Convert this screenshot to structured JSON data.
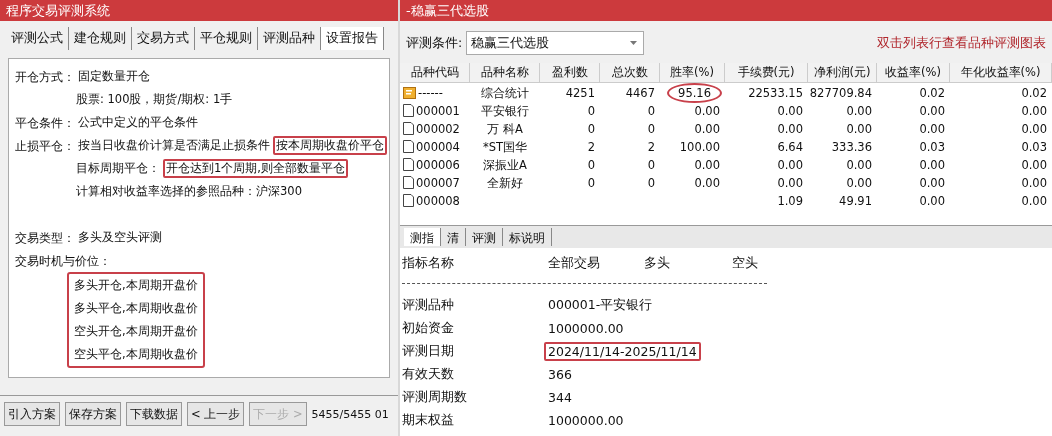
{
  "left_window": {
    "title": "程序交易评测系统",
    "tabs": [
      {
        "label": "评测公式",
        "selected": false
      },
      {
        "label": "建仓规则",
        "selected": false
      },
      {
        "label": "交易方式",
        "selected": false
      },
      {
        "label": "平仓规则",
        "selected": false
      },
      {
        "label": "评测品种",
        "selected": false
      },
      {
        "label": "设置报告",
        "selected": true
      }
    ],
    "settings": [
      {
        "label": "开仓方式：",
        "parts": [
          {
            "text": "固定数量开仓",
            "highlighted": false
          }
        ]
      },
      {
        "parts": [
          {
            "text": "股票: 100股，期货/期权: 1手",
            "highlighted": false
          }
        ]
      },
      {
        "label": "平仓条件：",
        "parts": [
          {
            "text": "公式中定义的平仓条件",
            "highlighted": false
          }
        ]
      },
      {
        "label": "止损平仓：",
        "parts": [
          {
            "text": "按当日收盘价计算是否满足止损条件",
            "highlighted": false
          },
          {
            "text": "按本周期收盘价平仓",
            "highlighted": true
          }
        ]
      },
      {
        "parts": [
          {
            "text": "目标周期平仓：",
            "highlighted": false
          },
          {
            "text": "开仓达到1个周期,则全部数量平仓",
            "highlighted": true
          }
        ]
      },
      {
        "parts": [
          {
            "text": "计算相对收益率选择的参照品种：沪深300",
            "highlighted": false
          }
        ]
      }
    ],
    "trade_settings": [
      {
        "label": "交易类型：",
        "parts": [
          {
            "text": "多头及空头评测",
            "highlighted": false
          }
        ]
      },
      {
        "label": "交易时机与价位："
      }
    ],
    "timing": {
      "highlighted": true,
      "lines": [
        "多头开仓,本周期开盘价",
        "多头平仓,本周期收盘价",
        "空头开仓,本周期开盘价",
        "空头平仓,本周期收盘价"
      ]
    },
    "buttons": [
      {
        "label": "引入方案",
        "disabled": false
      },
      {
        "label": "保存方案",
        "disabled": false
      },
      {
        "label": "下载数据",
        "disabled": false
      },
      {
        "label": "< 上一步",
        "disabled": false
      },
      {
        "label": "下一步 >",
        "disabled": true
      }
    ],
    "status": "5455/5455 01"
  },
  "right_window": {
    "title": "-稳赢三代选股",
    "condition_label": "评测条件:",
    "condition_value": "稳赢三代选股",
    "hint": "双击列表行查看品种评测图表",
    "table": {
      "columns": [
        "品种代码",
        "品种名称",
        "盈利数",
        "总次数",
        "胜率(%)",
        "手续费(元)",
        "净利润(元)",
        "收益率(%)",
        "年化收益率(%)"
      ],
      "rows": [
        {
          "kind": "summary",
          "win_rate_circled": true,
          "cells": [
            "------",
            "综合统计",
            "4251",
            "4467",
            "95.16",
            "22533.15",
            "827709.84",
            "0.02",
            "0.02"
          ]
        },
        {
          "kind": "stock",
          "cells": [
            "000001",
            "平安银行",
            "0",
            "0",
            "0.00",
            "0.00",
            "0.00",
            "0.00",
            "0.00"
          ]
        },
        {
          "kind": "stock",
          "cells": [
            "000002",
            "万 科A",
            "0",
            "0",
            "0.00",
            "0.00",
            "0.00",
            "0.00",
            "0.00"
          ]
        },
        {
          "kind": "stock",
          "cells": [
            "000004",
            "*ST国华",
            "2",
            "2",
            "100.00",
            "6.64",
            "333.36",
            "0.03",
            "0.03"
          ]
        },
        {
          "kind": "stock",
          "cells": [
            "000006",
            "深振业A",
            "0",
            "0",
            "0.00",
            "0.00",
            "0.00",
            "0.00",
            "0.00"
          ]
        },
        {
          "kind": "stock",
          "cells": [
            "000007",
            "全新好",
            "0",
            "0",
            "0.00",
            "0.00",
            "0.00",
            "0.00",
            "0.00"
          ]
        },
        {
          "kind": "stock",
          "cells": [
            "000008",
            null,
            null,
            null,
            null,
            "1.09",
            "49.91",
            "0.00",
            "0.00"
          ]
        }
      ]
    },
    "bottom_tabs": [
      {
        "label": "测指",
        "selected": true
      },
      {
        "label": "清",
        "selected": false
      },
      {
        "label": "评测",
        "selected": false
      },
      {
        "label": "标说明",
        "selected": false
      }
    ],
    "report": {
      "columns": [
        "指标名称",
        "全部交易",
        "多头",
        "空头"
      ],
      "rows": [
        {
          "label": "评测品种",
          "value": "000001-平安银行",
          "highlighted": false
        },
        {
          "label": "初始资金",
          "value": "1000000.00",
          "highlighted": false
        },
        {
          "label": "评测日期",
          "value": "2024/11/14-2025/11/14",
          "highlighted": true
        },
        {
          "label": "有效天数",
          "value": "366",
          "highlighted": false
        },
        {
          "label": "评测周期数",
          "value": "344",
          "highlighted": false
        },
        {
          "label": "期末权益",
          "value": "1000000.00",
          "highlighted": false
        }
      ]
    }
  }
}
